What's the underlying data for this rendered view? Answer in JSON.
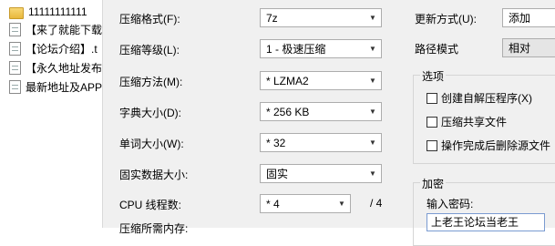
{
  "files": [
    {
      "icon": "folder-icon",
      "name": "11111111111"
    },
    {
      "icon": "doc-icon",
      "name": "【来了就能下载"
    },
    {
      "icon": "doc-icon",
      "name": "【论坛介绍】.t"
    },
    {
      "icon": "doc-icon",
      "name": "【永久地址发布"
    },
    {
      "icon": "doc-icon",
      "name": "最新地址及APP"
    }
  ],
  "format": {
    "label": "压缩格式(F):",
    "value": "7z"
  },
  "level": {
    "label": "压缩等级(L):",
    "value": "1 - 极速压缩"
  },
  "method": {
    "label": "压缩方法(M):",
    "value": "* LZMA2"
  },
  "dict": {
    "label": "字典大小(D):",
    "value": "* 256 KB"
  },
  "word": {
    "label": "单词大小(W):",
    "value": "* 32"
  },
  "solid": {
    "label": "固实数据大小:",
    "value": "固实"
  },
  "cpu": {
    "label": "CPU 线程数:",
    "value": "* 4",
    "total": "/ 4"
  },
  "memory": {
    "label": "压缩所需内存:"
  },
  "update": {
    "label": "更新方式(U):",
    "value": "添加"
  },
  "path": {
    "label": "路径模式",
    "value": "相对"
  },
  "options": {
    "title": "选项",
    "items": [
      {
        "label": "创建自解压程序(X)",
        "checked": false
      },
      {
        "label": "压缩共享文件",
        "checked": false
      },
      {
        "label": "操作完成后删除源文件",
        "checked": false
      }
    ]
  },
  "encryption": {
    "title": "加密",
    "password_label": "输入密码:",
    "password_value": "上老王论坛当老王"
  }
}
